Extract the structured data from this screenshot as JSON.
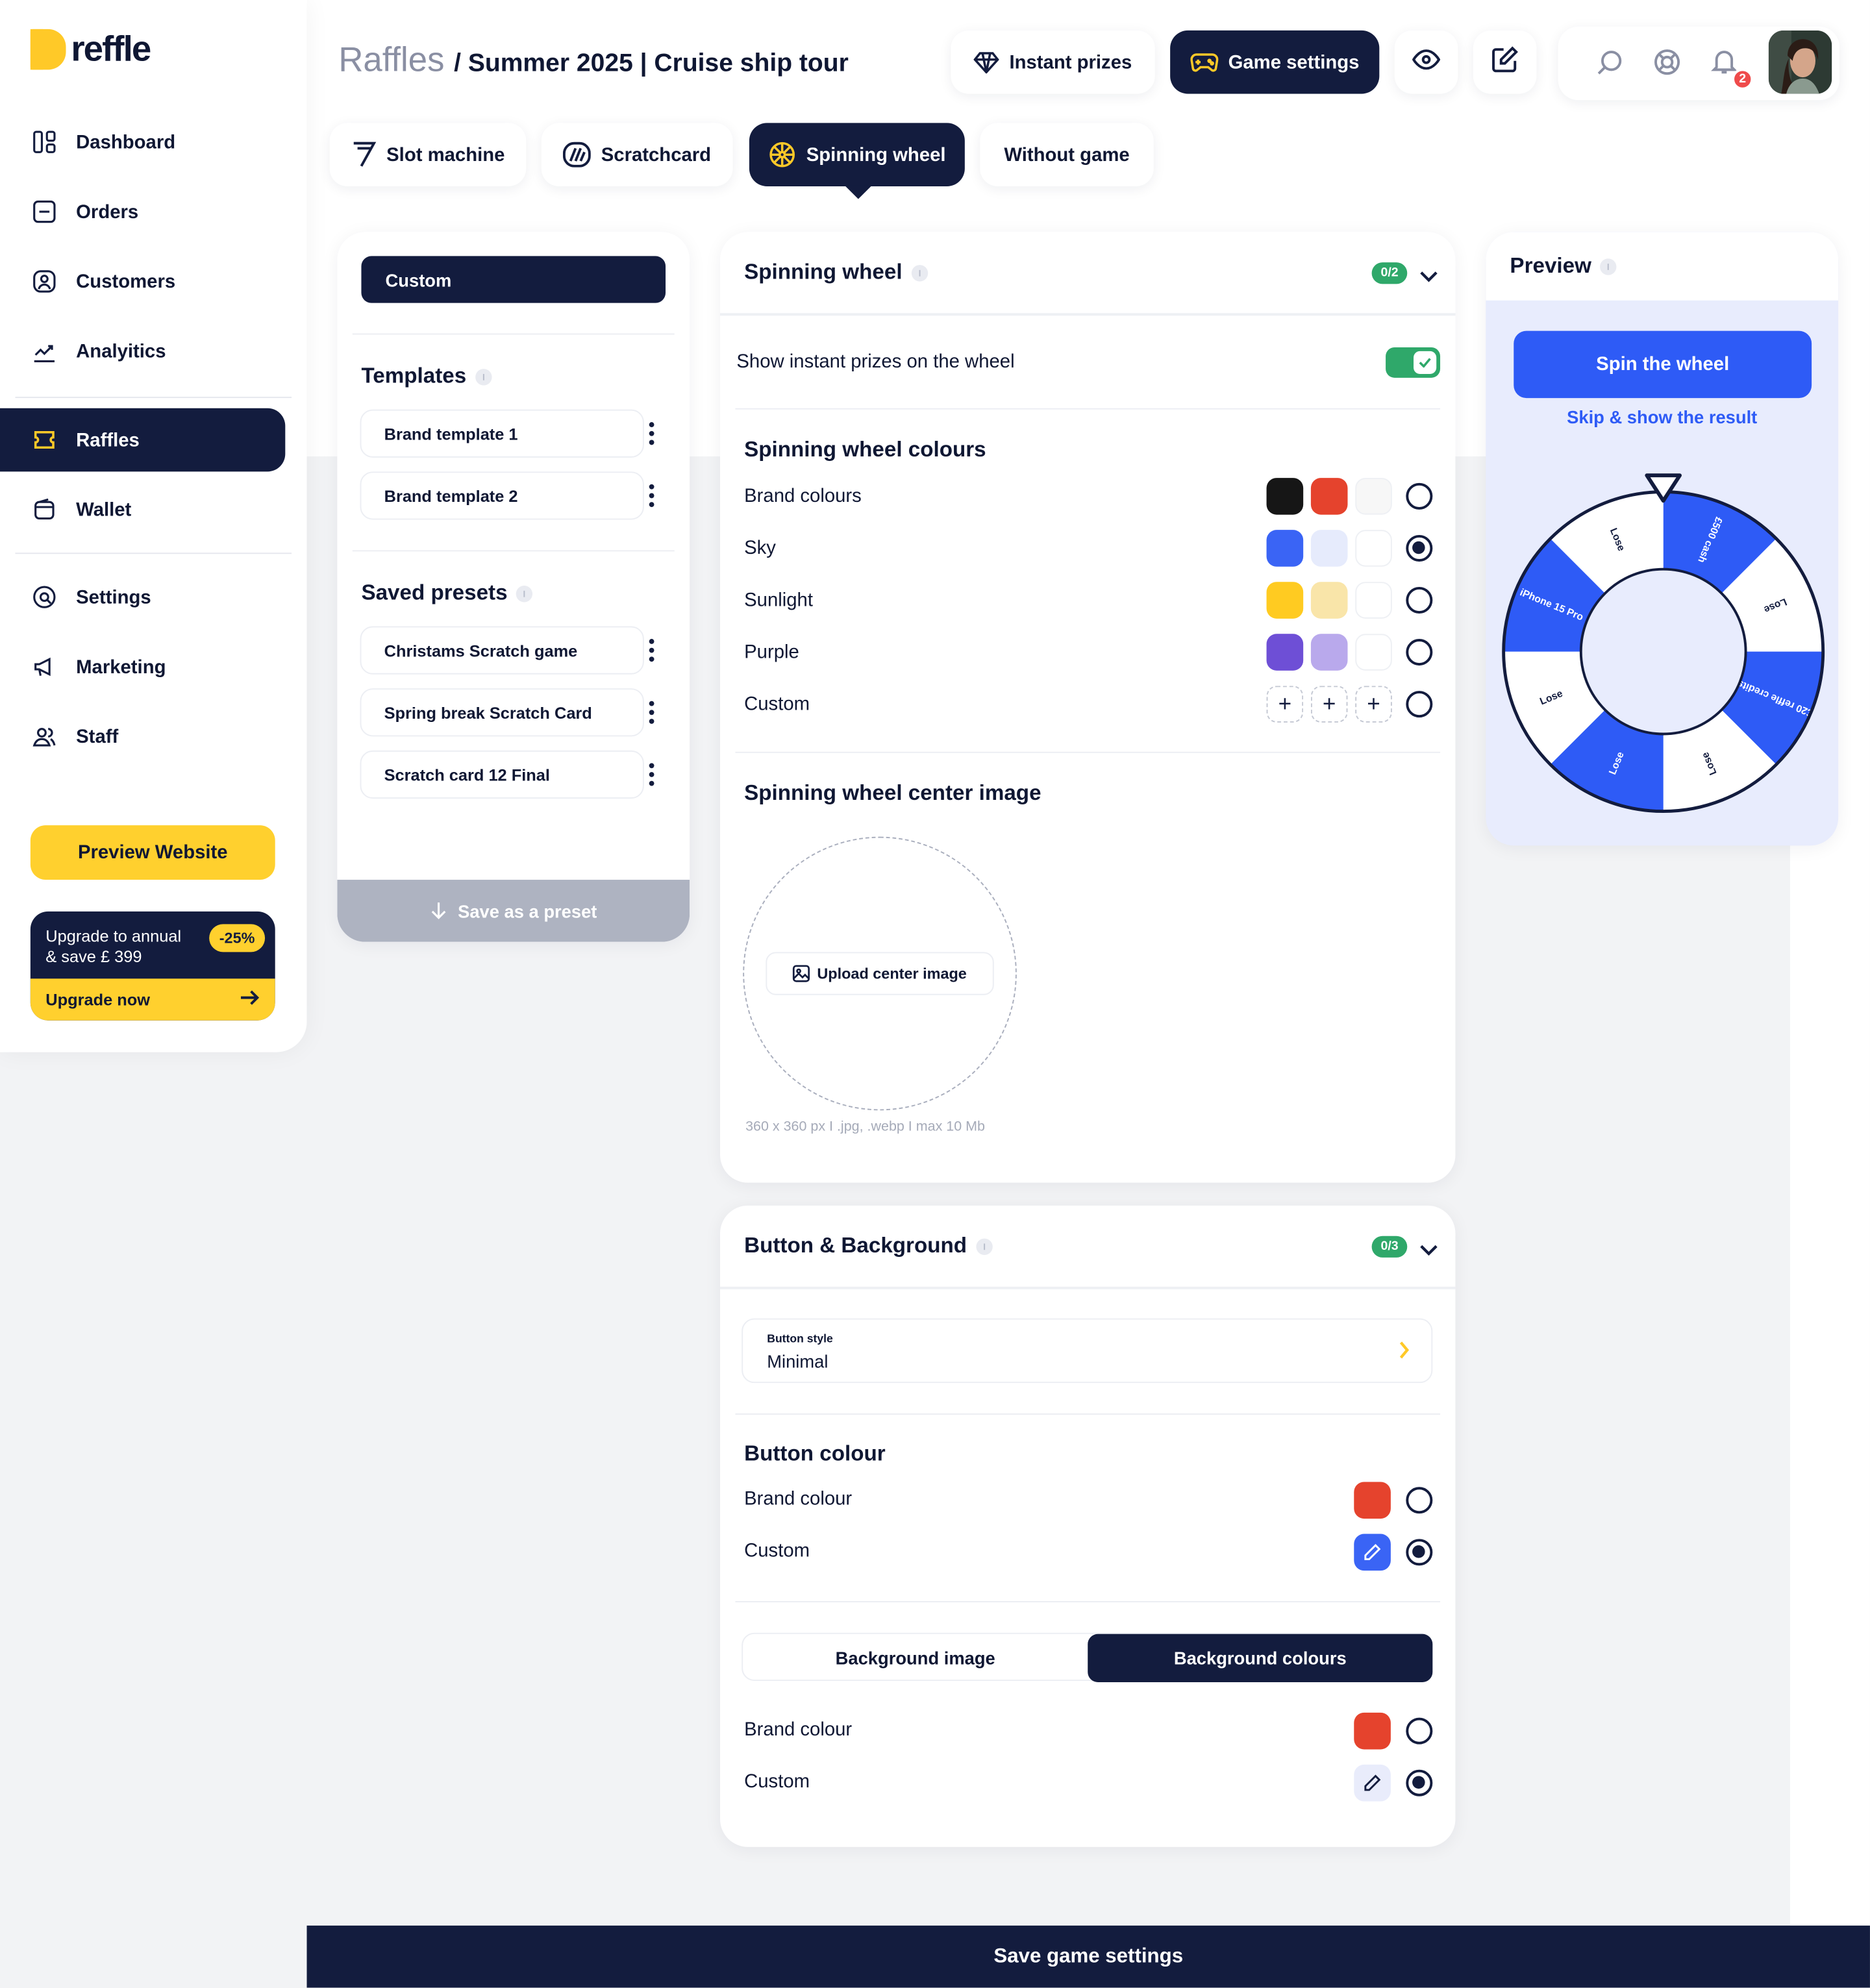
{
  "brand": {
    "name": "reffle",
    "accent": "#ffc928",
    "dark": "#131c3e",
    "blue": "#2e5bf6",
    "green": "#2fa86a"
  },
  "sidebar": {
    "items": [
      {
        "label": "Dashboard",
        "icon": "dashboard-icon"
      },
      {
        "label": "Orders",
        "icon": "orders-icon"
      },
      {
        "label": "Customers",
        "icon": "customers-icon"
      },
      {
        "label": "Analyitics",
        "icon": "analytics-icon"
      },
      {
        "label": "Raffles",
        "icon": "ticket-icon",
        "active": true
      },
      {
        "label": "Wallet",
        "icon": "wallet-icon"
      },
      {
        "label": "Settings",
        "icon": "settings-icon"
      },
      {
        "label": "Marketing",
        "icon": "megaphone-icon"
      },
      {
        "label": "Staff",
        "icon": "staff-icon"
      }
    ],
    "preview_label": "Preview Website",
    "upgrade": {
      "line1": "Upgrade to annual",
      "line2": "& save £ 399",
      "badge": "-25%",
      "cta": "Upgrade now"
    }
  },
  "header": {
    "breadcrumb_root": "Raffles",
    "breadcrumb_rest": "/ Summer 2025 | Cruise ship tour",
    "instant_prizes": "Instant prizes",
    "game_settings": "Game settings",
    "notifications_count": "2"
  },
  "tabs": [
    {
      "label": "Slot machine",
      "icon": "seven-icon"
    },
    {
      "label": "Scratchcard",
      "icon": "scratch-icon"
    },
    {
      "label": "Spinning wheel",
      "icon": "wheel-icon",
      "active": true
    },
    {
      "label": "Without game",
      "icon": ""
    }
  ],
  "presets_panel": {
    "custom_label": "Custom",
    "templates_title": "Templates",
    "templates": [
      "Brand template 1",
      "Brand template 2"
    ],
    "saved_title": "Saved presets",
    "saved": [
      "Christams Scratch game",
      "Spring break Scratch Card",
      "Scratch card 12 Final"
    ],
    "save_label": "Save as a preset"
  },
  "wheel_settings": {
    "title": "Spinning wheel",
    "count": "0/2",
    "show_prizes_label": "Show instant prizes on the wheel",
    "show_prizes_on": true,
    "colours_title": "Spinning wheel colours",
    "palettes": [
      {
        "label": "Brand colours",
        "colors": [
          "#161616",
          "#e5432d",
          "#f7f7f7"
        ],
        "selected": false
      },
      {
        "label": "Sky",
        "colors": [
          "#3a64f5",
          "#e6ebfc",
          "#ffffff"
        ],
        "selected": true
      },
      {
        "label": "Sunlight",
        "colors": [
          "#ffcb21",
          "#f9e5a9",
          "#ffffff"
        ],
        "selected": false
      },
      {
        "label": "Purple",
        "colors": [
          "#6e4fd6",
          "#b9a9ec",
          "#ffffff"
        ],
        "selected": false
      },
      {
        "label": "Custom",
        "colors": [],
        "selected": false
      }
    ],
    "center_image_title": "Spinning wheel center image",
    "upload_label": "Upload center image",
    "upload_hint": "360 x 360 px I .jpg, .webp I max 10 Mb"
  },
  "button_bg": {
    "title": "Button & Background",
    "count": "0/3",
    "button_style_label": "Button style",
    "button_style_value": "Minimal",
    "button_colour_title": "Button colour",
    "button_options": [
      {
        "label": "Brand colour",
        "color": "#e5432d",
        "selected": false
      },
      {
        "label": "Custom",
        "color": "#3a64f5",
        "selected": true
      }
    ],
    "bg_tabs": [
      "Background image",
      "Background colours"
    ],
    "bg_options": [
      {
        "label": "Brand colour",
        "color": "#e5432d",
        "selected": false
      },
      {
        "label": "Custom",
        "color": "#e9ecfb",
        "selected": true
      }
    ]
  },
  "preview": {
    "title": "Preview",
    "spin_label": "Spin the wheel",
    "skip_label": "Skip & show the result",
    "segments": [
      "£500 cash",
      "Lose",
      "£20 reffle credits",
      "Lose",
      "Lose",
      "Lose",
      "iPhone 15 Pro",
      "Lose"
    ]
  },
  "footer": {
    "save_label": "Save game settings"
  }
}
